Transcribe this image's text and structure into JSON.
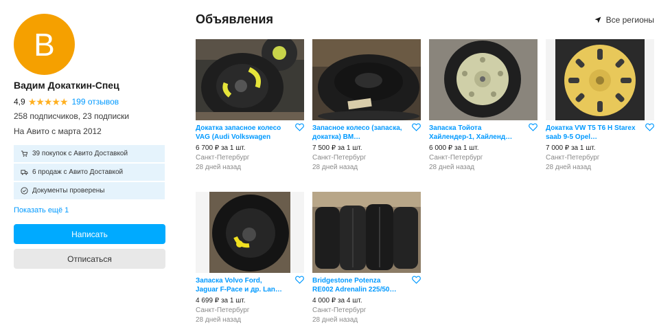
{
  "profile": {
    "avatar_letter": "В",
    "name": "Вадим Докаткин-Спец",
    "rating": "4,9",
    "reviews": "199 отзывов",
    "subs": "258 подписчиков, 23 подписки",
    "since": "На Авито с марта 2012",
    "badges": [
      {
        "icon": "cart-icon",
        "text": "39 покупок с Авито Доставкой"
      },
      {
        "icon": "truck-icon",
        "text": "6 продаж с Авито Доставкой"
      },
      {
        "icon": "check-circle-icon",
        "text": "Документы проверены"
      }
    ],
    "show_more": "Показать ещё 1",
    "write_button": "Написать",
    "unsubscribe_button": "Отписаться"
  },
  "listings": {
    "title": "Объявления",
    "region": "Все регионы",
    "items": [
      {
        "title": "Докатка запасное колесо VAG (Audi Volkswagen",
        "price": "6 700 ₽ за 1 шт.",
        "location": "Санкт-Петербург",
        "date": "28 дней назад"
      },
      {
        "title": "Запасное колесо (запаска, докатка) BM…",
        "price": "7 500 ₽ за 1 шт.",
        "location": "Санкт-Петербург",
        "date": "28 дней назад"
      },
      {
        "title": "Запаска Тойота Хайлендер-1, Хайленд…",
        "price": "6 000 ₽ за 1 шт.",
        "location": "Санкт-Петербург",
        "date": "28 дней назад"
      },
      {
        "title": "Докатка VW T5 T6 Н Starex saab 9-5 Opel…",
        "price": "7 000 ₽ за 1 шт.",
        "location": "Санкт-Петербург",
        "date": "28 дней назад"
      },
      {
        "title": "Запаска Volvo Ford, Jaguar F-Pace и др. Lan…",
        "price": "4 699 ₽ за 1 шт.",
        "location": "Санкт-Петербург",
        "date": "28 дней назад"
      },
      {
        "title": "Bridgestone Potenza RE002 Adrenalin 225/50…",
        "price": "4 000 ₽ за 4 шт.",
        "location": "Санкт-Петербург",
        "date": "28 дней назад"
      }
    ]
  },
  "colors": {
    "accent": "#00aaff",
    "link": "#0099ff",
    "avatar": "#f5a000",
    "star": "#ffb021"
  }
}
